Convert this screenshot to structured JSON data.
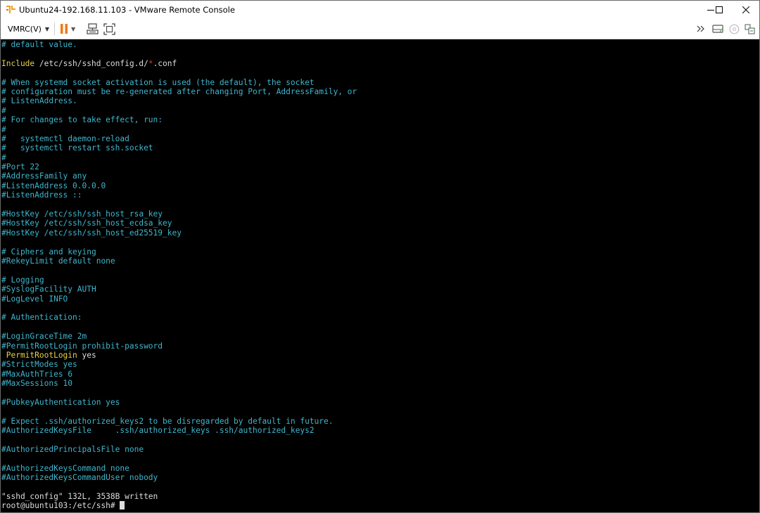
{
  "window": {
    "title": "Ubuntu24-192.168.11.103 - VMware Remote Console"
  },
  "toolbar": {
    "vmrc_menu_label": "VMRC(V)"
  },
  "colors": {
    "comment": "#3fb6cd",
    "keyword": "#e8d04a",
    "glob": "#e0362c",
    "text": "#dcdcdc",
    "background": "#000000"
  },
  "terminal": {
    "lines": [
      {
        "segments": [
          {
            "text": "# default value.",
            "color": "cyan"
          }
        ]
      },
      {
        "segments": []
      },
      {
        "segments": [
          {
            "text": "Include",
            "color": "yellow"
          },
          {
            "text": " /etc/ssh/sshd_config.d/",
            "color": "white"
          },
          {
            "text": "*",
            "color": "red"
          },
          {
            "text": ".conf",
            "color": "white"
          }
        ]
      },
      {
        "segments": []
      },
      {
        "segments": [
          {
            "text": "# When systemd socket activation is used (the default), the socket",
            "color": "cyan"
          }
        ]
      },
      {
        "segments": [
          {
            "text": "# configuration must be re-generated after changing Port, AddressFamily, or",
            "color": "cyan"
          }
        ]
      },
      {
        "segments": [
          {
            "text": "# ListenAddress.",
            "color": "cyan"
          }
        ]
      },
      {
        "segments": [
          {
            "text": "#",
            "color": "cyan"
          }
        ]
      },
      {
        "segments": [
          {
            "text": "# For changes to take effect, run:",
            "color": "cyan"
          }
        ]
      },
      {
        "segments": [
          {
            "text": "#",
            "color": "cyan"
          }
        ]
      },
      {
        "segments": [
          {
            "text": "#   systemctl daemon-reload",
            "color": "cyan"
          }
        ]
      },
      {
        "segments": [
          {
            "text": "#   systemctl restart ssh.socket",
            "color": "cyan"
          }
        ]
      },
      {
        "segments": [
          {
            "text": "#",
            "color": "cyan"
          }
        ]
      },
      {
        "segments": [
          {
            "text": "#Port 22",
            "color": "cyan"
          }
        ]
      },
      {
        "segments": [
          {
            "text": "#AddressFamily any",
            "color": "cyan"
          }
        ]
      },
      {
        "segments": [
          {
            "text": "#ListenAddress 0.0.0.0",
            "color": "cyan"
          }
        ]
      },
      {
        "segments": [
          {
            "text": "#ListenAddress ::",
            "color": "cyan"
          }
        ]
      },
      {
        "segments": []
      },
      {
        "segments": [
          {
            "text": "#HostKey /etc/ssh/ssh_host_rsa_key",
            "color": "cyan"
          }
        ]
      },
      {
        "segments": [
          {
            "text": "#HostKey /etc/ssh/ssh_host_ecdsa_key",
            "color": "cyan"
          }
        ]
      },
      {
        "segments": [
          {
            "text": "#HostKey /etc/ssh/ssh_host_ed25519_key",
            "color": "cyan"
          }
        ]
      },
      {
        "segments": []
      },
      {
        "segments": [
          {
            "text": "# Ciphers and keying",
            "color": "cyan"
          }
        ]
      },
      {
        "segments": [
          {
            "text": "#RekeyLimit default none",
            "color": "cyan"
          }
        ]
      },
      {
        "segments": []
      },
      {
        "segments": [
          {
            "text": "# Logging",
            "color": "cyan"
          }
        ]
      },
      {
        "segments": [
          {
            "text": "#SyslogFacility AUTH",
            "color": "cyan"
          }
        ]
      },
      {
        "segments": [
          {
            "text": "#LogLevel INFO",
            "color": "cyan"
          }
        ]
      },
      {
        "segments": []
      },
      {
        "segments": [
          {
            "text": "# Authentication:",
            "color": "cyan"
          }
        ]
      },
      {
        "segments": []
      },
      {
        "segments": [
          {
            "text": "#LoginGraceTime 2m",
            "color": "cyan"
          }
        ]
      },
      {
        "segments": [
          {
            "text": "#PermitRootLogin prohibit-password",
            "color": "cyan"
          }
        ]
      },
      {
        "segments": [
          {
            "text": " PermitRootLogin",
            "color": "yellow"
          },
          {
            "text": " yes",
            "color": "white"
          }
        ]
      },
      {
        "segments": [
          {
            "text": "#StrictModes yes",
            "color": "cyan"
          }
        ]
      },
      {
        "segments": [
          {
            "text": "#MaxAuthTries 6",
            "color": "cyan"
          }
        ]
      },
      {
        "segments": [
          {
            "text": "#MaxSessions 10",
            "color": "cyan"
          }
        ]
      },
      {
        "segments": []
      },
      {
        "segments": [
          {
            "text": "#PubkeyAuthentication yes",
            "color": "cyan"
          }
        ]
      },
      {
        "segments": []
      },
      {
        "segments": [
          {
            "text": "# Expect .ssh/authorized_keys2 to be disregarded by default in future.",
            "color": "cyan"
          }
        ]
      },
      {
        "segments": [
          {
            "text": "#AuthorizedKeysFile     .ssh/authorized_keys .ssh/authorized_keys2",
            "color": "cyan"
          }
        ]
      },
      {
        "segments": []
      },
      {
        "segments": [
          {
            "text": "#AuthorizedPrincipalsFile none",
            "color": "cyan"
          }
        ]
      },
      {
        "segments": []
      },
      {
        "segments": [
          {
            "text": "#AuthorizedKeysCommand none",
            "color": "cyan"
          }
        ]
      },
      {
        "segments": [
          {
            "text": "#AuthorizedKeysCommandUser nobody",
            "color": "cyan"
          }
        ]
      },
      {
        "segments": []
      },
      {
        "segments": [
          {
            "text": "\"sshd_config\" 132L, 3538B written",
            "color": "white"
          }
        ]
      },
      {
        "segments": [
          {
            "text": "root@ubuntu103:/etc/ssh# ",
            "color": "white"
          }
        ],
        "cursor": true
      }
    ]
  }
}
